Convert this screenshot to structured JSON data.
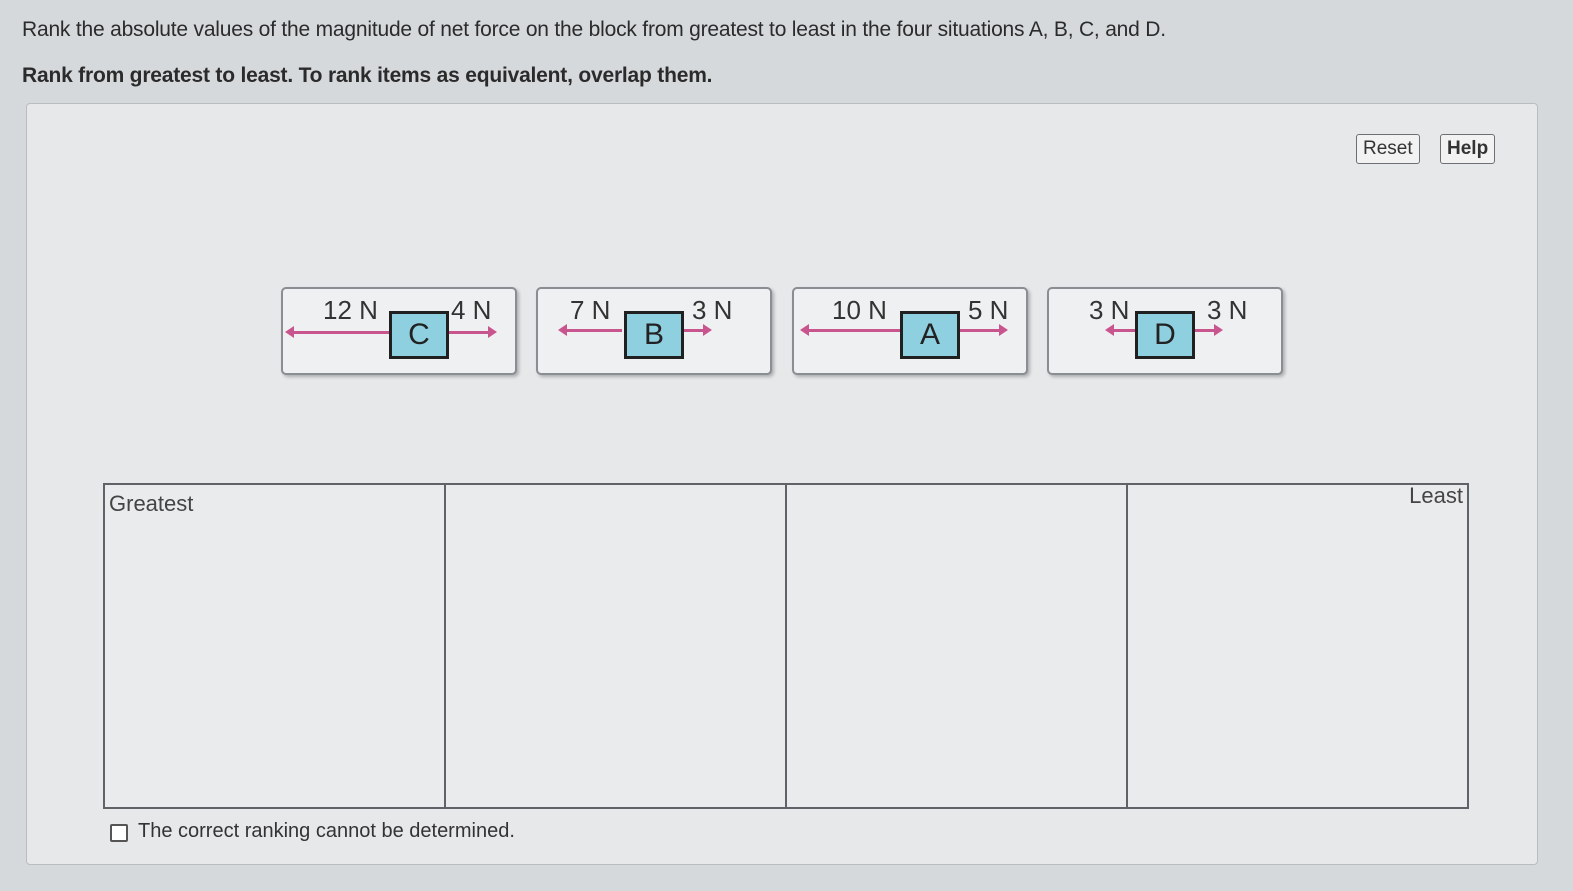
{
  "question": {
    "prompt": "Rank the absolute values of the magnitude of net force on the block from greatest to least in the four situations A, B, C, and D.",
    "instruction": "Rank from greatest to least. To rank items as equivalent, overlap them."
  },
  "toolbar": {
    "reset_label": "Reset",
    "help_label": "Help"
  },
  "cards": [
    {
      "block": "C",
      "left_force": "12 N",
      "right_force": "4 N"
    },
    {
      "block": "B",
      "left_force": "7 N",
      "right_force": "3 N"
    },
    {
      "block": "A",
      "left_force": "10 N",
      "right_force": "5 N"
    },
    {
      "block": "D",
      "left_force": "3 N",
      "right_force": "3 N"
    }
  ],
  "ranking": {
    "greatest_label": "Greatest",
    "least_label": "Least"
  },
  "options": {
    "cannot_determine_label": "The correct ranking cannot be determined."
  },
  "colors": {
    "block_fill": "#8ecfe0",
    "force_arrow": "#c9558f"
  }
}
